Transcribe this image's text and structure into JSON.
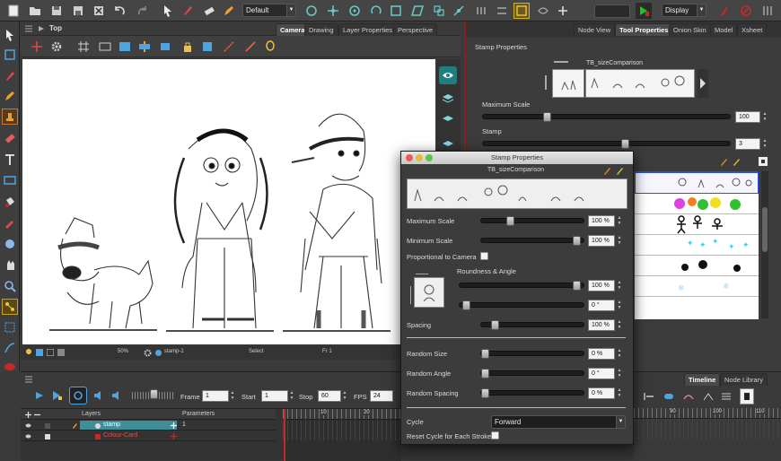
{
  "toolbar": {
    "workspace_select": "Default",
    "display_select": "Display"
  },
  "viewport": {
    "view_title": "Top",
    "tabs": [
      "Camera",
      "Drawing",
      "Layer Properties",
      "Perspective"
    ],
    "status": {
      "zoom": "50%",
      "drawing": "stamp-1",
      "tool": "Select",
      "frame": "Fr 1"
    }
  },
  "right_panel": {
    "tabs": [
      "Node View",
      "Tool Properties",
      "Onion Skin",
      "Model",
      "Xsheet"
    ],
    "section_title": "Stamp Properties",
    "stamp_name": "TB_sizeComparison",
    "max_scale_label": "Maximum Scale",
    "max_scale_value": "100",
    "max_scale_level": 0.25,
    "stamp_label": "Stamp",
    "stamp_value": "3",
    "stamp_level": 0.58
  },
  "dialog": {
    "title": "Stamp Properties",
    "stamp_name": "TB_sizeComparison",
    "rows": {
      "max_scale": {
        "label": "Maximum Scale",
        "value": "100 %",
        "level": 0.27
      },
      "min_scale": {
        "label": "Minimum Scale",
        "value": "100 %",
        "level": 0.97
      },
      "proportional": {
        "label": "Proportional to Camera"
      },
      "roundness_angle": {
        "label": "Roundness & Angle",
        "roundness": "100 %",
        "roundness_level": 0.98,
        "angle": "0 °",
        "angle_level": 0.02
      },
      "spacing": {
        "label": "Spacing",
        "value": "100 %",
        "level": 0.1
      },
      "random_size": {
        "label": "Random Size",
        "value": "0 %",
        "level": 0.0
      },
      "random_angle": {
        "label": "Random Angle",
        "value": "0 °",
        "level": 0.0
      },
      "random_spacing": {
        "label": "Random Spacing",
        "value": "0 %",
        "level": 0.0
      },
      "cycle": {
        "label": "Cycle",
        "value": "Forward"
      },
      "reset_cycle": {
        "label": "Reset Cycle for Each Stroke"
      }
    }
  },
  "bottom": {
    "frame_label": "Frame",
    "frame_value": "1",
    "start_label": "Start",
    "start_value": "1",
    "stop_label": "Stop",
    "stop_value": "60",
    "fps_label": "FPS",
    "fps_value": "24",
    "layers_header": "Layers",
    "params_header": "Parameters",
    "layers": [
      {
        "name": "stamp",
        "value": "1"
      },
      {
        "name": "Colour-Card",
        "value": ""
      }
    ],
    "frame_ruler": [
      "10",
      "20"
    ]
  },
  "timeline_panel": {
    "tabs": [
      "Timeline",
      "Node Library"
    ],
    "ruler": [
      "90",
      "100",
      "110"
    ]
  },
  "colors": {
    "accent_red": "#c62828",
    "selected_layer": "#3f8f98"
  }
}
